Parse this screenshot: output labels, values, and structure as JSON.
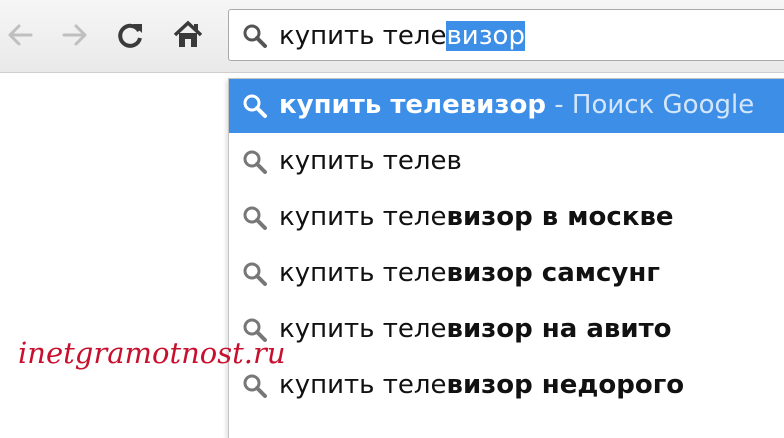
{
  "browser": {
    "toolbar": {
      "back_icon": "back-arrow-icon",
      "forward_icon": "forward-arrow-icon",
      "reload_icon": "reload-icon",
      "home_icon": "home-icon"
    },
    "omnibox": {
      "typed": "купить теле",
      "autocomplete": "визор",
      "icon": "search-icon"
    }
  },
  "dropdown": {
    "active": {
      "text": "купить телевизор",
      "hint": " - Поиск Google"
    },
    "suggestions": [
      {
        "base": "купить телев",
        "bold": ""
      },
      {
        "base": "купить теле",
        "bold": "визор в москве"
      },
      {
        "base": "купить теле",
        "bold": "визор самсунг"
      },
      {
        "base": "купить теле",
        "bold": "визор на авито"
      },
      {
        "base": "купить теле",
        "bold": "визор недорого"
      }
    ]
  },
  "watermark": "inetgramotnost.ru",
  "colors": {
    "selection": "#3d8ee6",
    "watermark": "#c8102e"
  }
}
